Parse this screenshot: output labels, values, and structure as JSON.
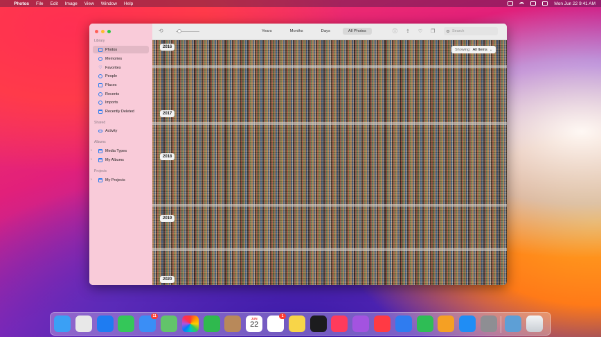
{
  "menubar": {
    "app_name": "Photos",
    "items": [
      "File",
      "Edit",
      "Image",
      "View",
      "Window",
      "Help"
    ],
    "datetime": "Mon Jun 22  9:41 AM"
  },
  "sidebar": {
    "library_label": "Library",
    "library_items": [
      "Photos",
      "Memories",
      "Favorites",
      "People",
      "Places",
      "Recents",
      "Imports",
      "Recently Deleted"
    ],
    "shared_label": "Shared",
    "shared_items": [
      "Activity"
    ],
    "albums_label": "Albums",
    "album_items": [
      "Media Types",
      "My Albums"
    ],
    "projects_label": "Projects",
    "project_items": [
      "My Projects"
    ]
  },
  "toolbar": {
    "tabs": [
      "Years",
      "Months",
      "Days",
      "All Photos"
    ],
    "active_tab": "All Photos",
    "search_placeholder": "Search"
  },
  "grid": {
    "showing_label": "Showing:",
    "showing_value": "All Items",
    "years": [
      "2016",
      "2017",
      "2018",
      "2019",
      "2020"
    ]
  },
  "dock": {
    "apps": [
      {
        "name": "Finder",
        "color": "#3aa0f5"
      },
      {
        "name": "Launchpad",
        "color": "#e8e8e8"
      },
      {
        "name": "Safari",
        "color": "#1e7cf2"
      },
      {
        "name": "Messages",
        "color": "#34c759"
      },
      {
        "name": "Mail",
        "color": "#3a8ef6",
        "badge": "11"
      },
      {
        "name": "Maps",
        "color": "#62c46a"
      },
      {
        "name": "Photos",
        "color": "#ffffff"
      },
      {
        "name": "FaceTime",
        "color": "#2fb94e"
      },
      {
        "name": "Contacts",
        "color": "#b8895a"
      },
      {
        "name": "Calendar",
        "color": "#ffffff",
        "month": "JUN",
        "day": "22"
      },
      {
        "name": "Reminders",
        "color": "#ffffff",
        "badge": "1"
      },
      {
        "name": "Notes",
        "color": "#f8d548"
      },
      {
        "name": "Apple TV",
        "color": "#1c1c1e"
      },
      {
        "name": "Music",
        "color": "#ff3b5c"
      },
      {
        "name": "Podcasts",
        "color": "#a353e0"
      },
      {
        "name": "News",
        "color": "#ff3a44"
      },
      {
        "name": "Keynote",
        "color": "#2f7cf0"
      },
      {
        "name": "Numbers",
        "color": "#2ebd55"
      },
      {
        "name": "Pages",
        "color": "#f5a023"
      },
      {
        "name": "App Store",
        "color": "#1f8df5"
      },
      {
        "name": "System Preferences",
        "color": "#8e8e93"
      },
      {
        "name": "Preview",
        "color": "#5d9fd6"
      },
      {
        "name": "Trash",
        "color": "#d8dde3"
      }
    ]
  }
}
